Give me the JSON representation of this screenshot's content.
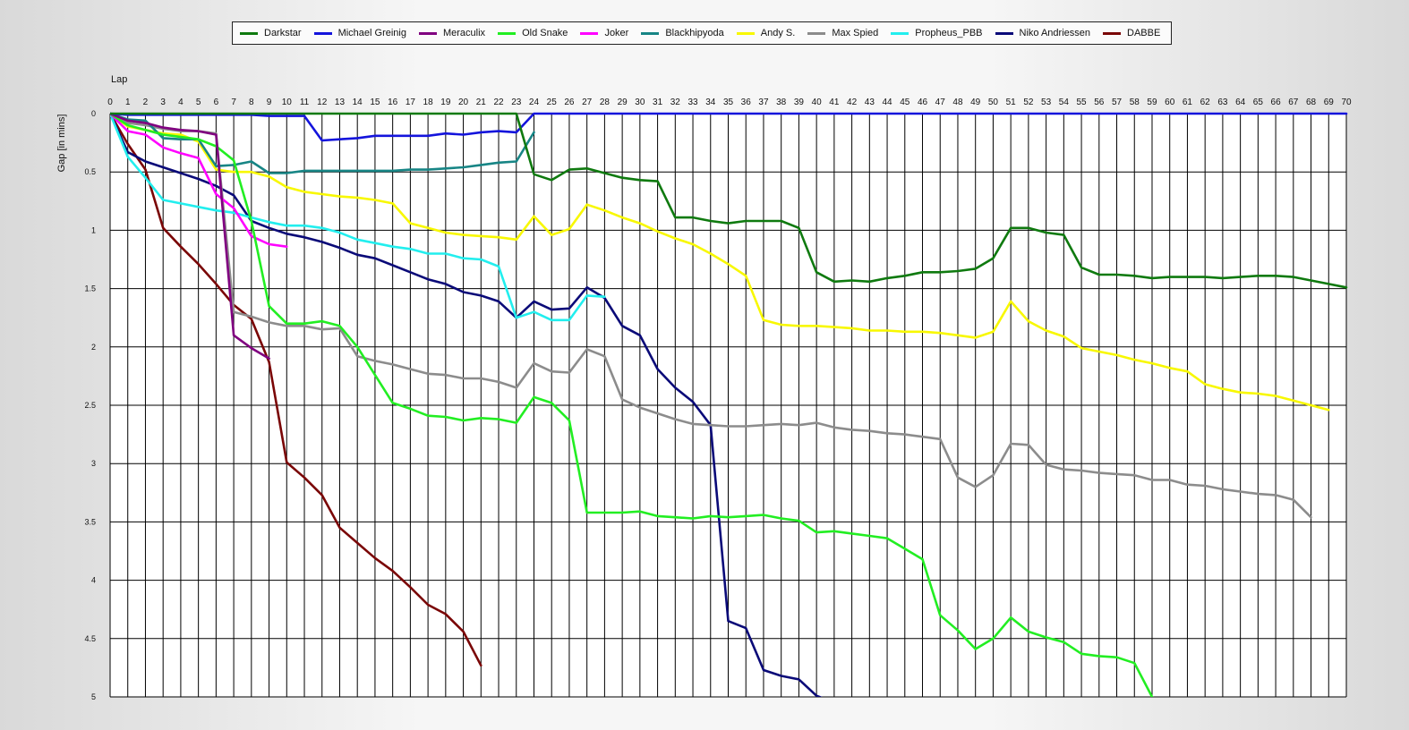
{
  "chart_data": {
    "type": "line",
    "xlabel": "Lap",
    "ylabel": "Gap [in mins]",
    "xlim": [
      0,
      70
    ],
    "ylim": [
      0,
      5
    ],
    "y_inverted": true,
    "grid": true,
    "legend_position": "top",
    "x_ticks": [
      0,
      1,
      2,
      3,
      4,
      5,
      6,
      7,
      8,
      9,
      10,
      11,
      12,
      13,
      14,
      15,
      16,
      17,
      18,
      19,
      20,
      21,
      22,
      23,
      24,
      25,
      26,
      27,
      28,
      29,
      30,
      31,
      32,
      33,
      34,
      35,
      36,
      37,
      38,
      39,
      40,
      41,
      42,
      43,
      44,
      45,
      46,
      47,
      48,
      49,
      50,
      51,
      52,
      53,
      54,
      55,
      56,
      57,
      58,
      59,
      60,
      61,
      62,
      63,
      64,
      65,
      66,
      67,
      68,
      69,
      70
    ],
    "y_ticks": [
      0,
      0.5,
      1,
      1.5,
      2,
      2.5,
      3,
      3.5,
      4,
      4.5,
      5
    ],
    "y_tick_labels": [
      "0",
      "0.5",
      "1",
      "1.5",
      "2",
      "2.5",
      "3",
      "3.5",
      "4",
      "4.5",
      "5"
    ],
    "series": [
      {
        "name": "Darkstar",
        "color": "#0f7a0f",
        "start_lap": 0,
        "values": [
          0,
          0,
          0,
          0,
          0,
          0,
          0,
          0,
          0,
          0,
          0,
          0,
          0,
          0,
          0,
          0,
          0,
          0,
          0,
          0,
          0,
          0,
          0,
          0,
          0.52,
          0.57,
          0.48,
          0.47,
          0.51,
          0.55,
          0.57,
          0.58,
          0.89,
          0.89,
          0.92,
          0.94,
          0.92,
          0.92,
          0.92,
          0.98,
          1.36,
          1.44,
          1.43,
          1.44,
          1.41,
          1.39,
          1.36,
          1.36,
          1.35,
          1.33,
          1.24,
          0.98,
          0.98,
          1.02,
          1.04,
          1.32,
          1.38,
          1.38,
          1.39,
          1.41,
          1.4,
          1.4,
          1.4,
          1.41,
          1.4,
          1.39,
          1.39,
          1.4,
          1.43,
          1.46,
          1.49
        ]
      },
      {
        "name": "Michael Greinig",
        "color": "#1414dc",
        "start_lap": 0,
        "values": [
          0,
          0.01,
          0.01,
          0.01,
          0.01,
          0.01,
          0.01,
          0.01,
          0.01,
          0.02,
          0.02,
          0.02,
          0.23,
          0.22,
          0.21,
          0.19,
          0.19,
          0.19,
          0.19,
          0.17,
          0.18,
          0.16,
          0.15,
          0.16,
          0,
          0,
          0,
          0,
          0,
          0,
          0,
          0,
          0,
          0,
          0,
          0,
          0,
          0,
          0,
          0,
          0,
          0,
          0,
          0,
          0,
          0,
          0,
          0,
          0,
          0,
          0,
          0,
          0,
          0,
          0,
          0,
          0,
          0,
          0,
          0,
          0,
          0,
          0,
          0,
          0,
          0,
          0,
          0,
          0,
          0,
          0
        ]
      },
      {
        "name": "Meraculix",
        "color": "#800080",
        "start_lap": 0,
        "values": [
          0,
          0.06,
          0.08,
          0.12,
          0.14,
          0.15,
          0.18,
          1.9,
          2.01,
          2.1
        ]
      },
      {
        "name": "Old Snake",
        "color": "#22ee22",
        "start_lap": 0,
        "values": [
          0,
          0.1,
          0.14,
          0.18,
          0.2,
          0.22,
          0.28,
          0.4,
          0.92,
          1.65,
          1.8,
          1.8,
          1.78,
          1.82,
          2.0,
          2.24,
          2.48,
          2.53,
          2.59,
          2.6,
          2.63,
          2.61,
          2.62,
          2.65,
          2.43,
          2.48,
          2.63,
          3.42,
          3.42,
          3.42,
          3.41,
          3.45,
          3.46,
          3.47,
          3.45,
          3.46,
          3.45,
          3.44,
          3.47,
          3.49,
          3.59,
          3.58,
          3.6,
          3.62,
          3.64,
          3.73,
          3.82,
          4.3,
          4.43,
          4.59,
          4.5,
          4.32,
          4.44,
          4.49,
          4.53,
          4.63,
          4.65,
          4.66,
          4.71,
          5.0
        ]
      },
      {
        "name": "Joker",
        "color": "#ff00ff",
        "start_lap": 0,
        "values": [
          0,
          0.15,
          0.18,
          0.29,
          0.34,
          0.38,
          0.69,
          0.81,
          1.05,
          1.12,
          1.14
        ]
      },
      {
        "name": "Blackhipyoda",
        "color": "#178585",
        "start_lap": 0,
        "values": [
          0,
          0.05,
          0.06,
          0.21,
          0.22,
          0.22,
          0.45,
          0.44,
          0.41,
          0.51,
          0.51,
          0.49,
          0.49,
          0.49,
          0.49,
          0.49,
          0.49,
          0.48,
          0.48,
          0.47,
          0.46,
          0.44,
          0.42,
          0.41,
          0.16
        ]
      },
      {
        "name": "Andy S.",
        "color": "#f8f800",
        "start_lap": 0,
        "values": [
          0,
          0.11,
          0.14,
          0.17,
          0.18,
          0.24,
          0.48,
          0.5,
          0.5,
          0.54,
          0.63,
          0.67,
          0.69,
          0.71,
          0.72,
          0.74,
          0.77,
          0.94,
          0.98,
          1.02,
          1.04,
          1.05,
          1.06,
          1.08,
          0.88,
          1.04,
          0.99,
          0.78,
          0.83,
          0.89,
          0.94,
          1.01,
          1.07,
          1.12,
          1.2,
          1.29,
          1.39,
          1.77,
          1.81,
          1.82,
          1.82,
          1.83,
          1.84,
          1.86,
          1.86,
          1.87,
          1.87,
          1.88,
          1.9,
          1.92,
          1.87,
          1.61,
          1.78,
          1.86,
          1.91,
          2.01,
          2.04,
          2.07,
          2.11,
          2.14,
          2.18,
          2.21,
          2.32,
          2.36,
          2.39,
          2.4,
          2.42,
          2.46,
          2.5,
          2.54
        ]
      },
      {
        "name": "Max Spied",
        "color": "#8c8c8c",
        "start_lap": 0,
        "values": [
          0,
          0.08,
          0.1,
          0.13,
          0.15,
          0.15,
          0.17,
          1.7,
          1.74,
          1.79,
          1.82,
          1.82,
          1.85,
          1.84,
          2.08,
          2.12,
          2.15,
          2.19,
          2.23,
          2.24,
          2.27,
          2.27,
          2.3,
          2.35,
          2.14,
          2.21,
          2.22,
          2.02,
          2.08,
          2.45,
          2.52,
          2.57,
          2.62,
          2.66,
          2.67,
          2.68,
          2.68,
          2.67,
          2.66,
          2.67,
          2.65,
          2.69,
          2.71,
          2.72,
          2.74,
          2.75,
          2.77,
          2.79,
          3.12,
          3.2,
          3.1,
          2.83,
          2.84,
          3.01,
          3.05,
          3.06,
          3.08,
          3.09,
          3.1,
          3.14,
          3.14,
          3.18,
          3.19,
          3.22,
          3.24,
          3.26,
          3.27,
          3.31,
          3.46
        ]
      },
      {
        "name": "Propheus_PBB",
        "color": "#22eeee",
        "start_lap": 0,
        "values": [
          0,
          0.37,
          0.55,
          0.74,
          0.77,
          0.8,
          0.83,
          0.85,
          0.89,
          0.93,
          0.96,
          0.96,
          0.98,
          1.02,
          1.08,
          1.11,
          1.14,
          1.16,
          1.2,
          1.2,
          1.24,
          1.25,
          1.31,
          1.75,
          1.7,
          1.77,
          1.77,
          1.56,
          1.57
        ]
      },
      {
        "name": "Niko Andriessen",
        "color": "#0a0a78",
        "start_lap": 0,
        "values": [
          0,
          0.33,
          0.41,
          0.46,
          0.51,
          0.56,
          0.62,
          0.7,
          0.92,
          0.98,
          1.03,
          1.06,
          1.1,
          1.15,
          1.21,
          1.24,
          1.3,
          1.36,
          1.42,
          1.46,
          1.53,
          1.56,
          1.61,
          1.75,
          1.61,
          1.68,
          1.67,
          1.49,
          1.58,
          1.82,
          1.9,
          2.19,
          2.35,
          2.47,
          2.67,
          4.35,
          4.41,
          4.77,
          4.82,
          4.85,
          4.99,
          5.05
        ]
      },
      {
        "name": "DABBE",
        "color": "#7a0606",
        "start_lap": 0,
        "values": [
          0,
          0.26,
          0.48,
          0.98,
          1.14,
          1.29,
          1.46,
          1.64,
          1.76,
          2.13,
          2.99,
          3.12,
          3.27,
          3.55,
          3.68,
          3.81,
          3.92,
          4.06,
          4.21,
          4.29,
          4.44,
          4.73
        ]
      }
    ]
  }
}
